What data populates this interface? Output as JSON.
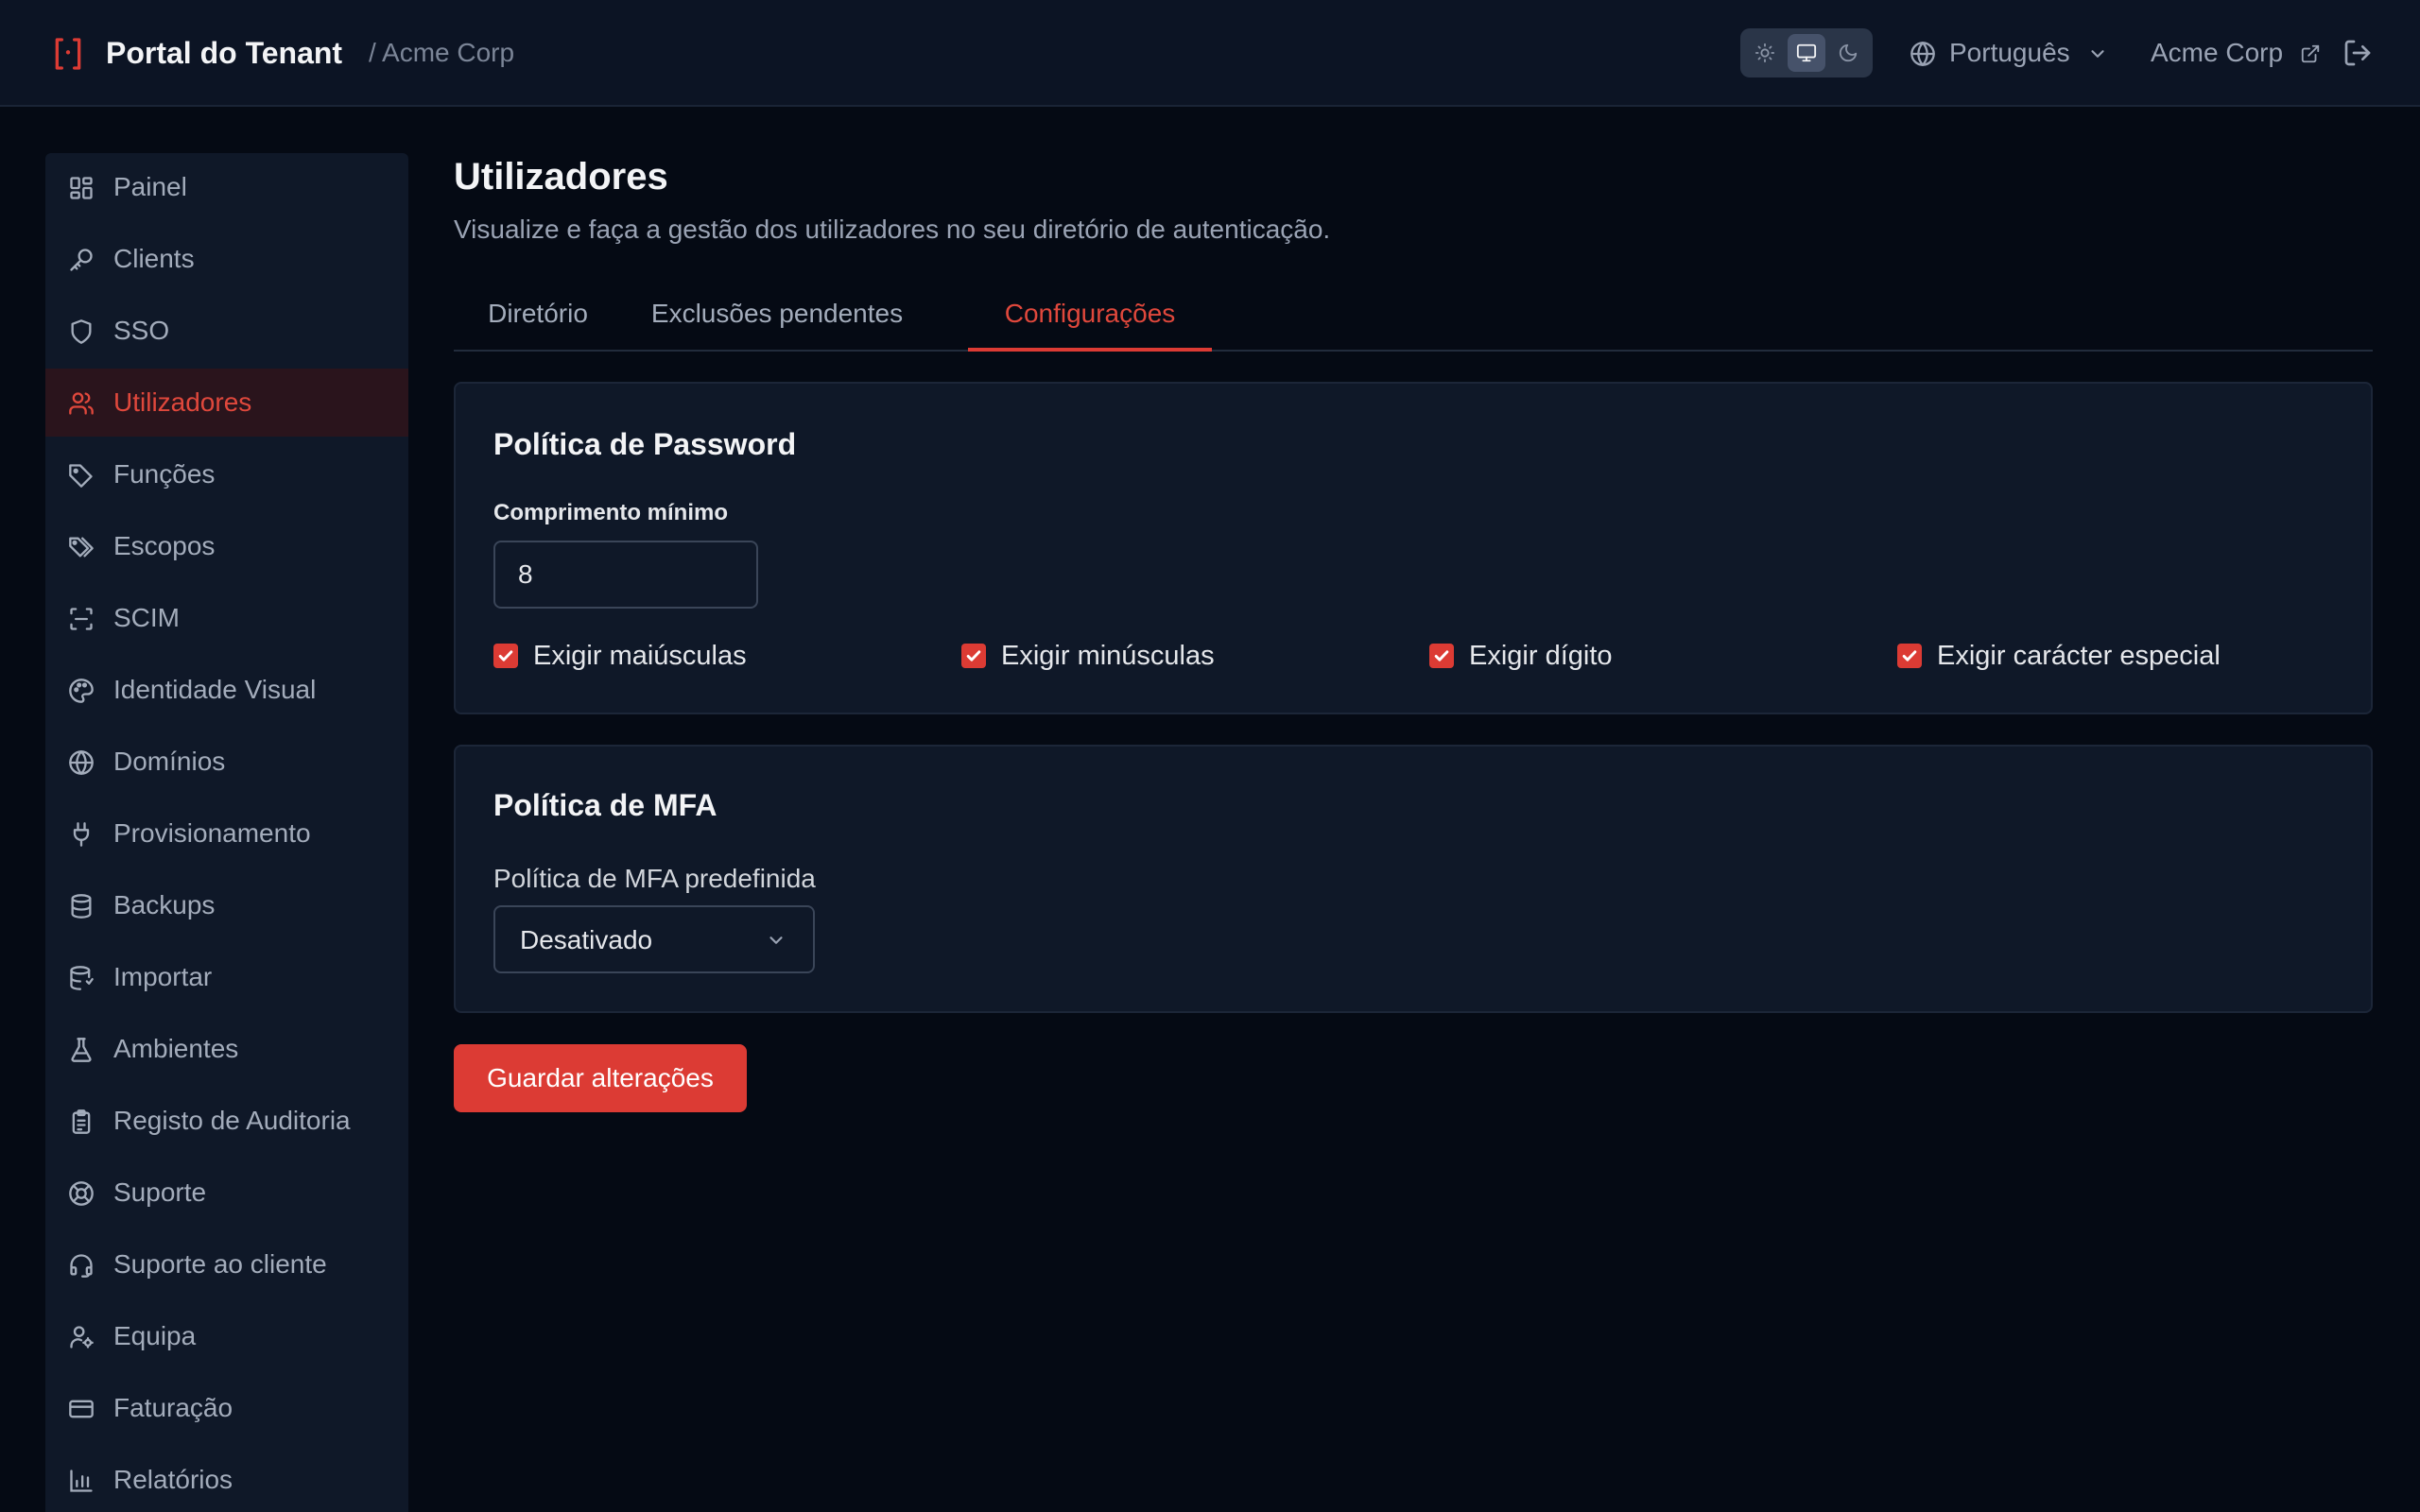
{
  "header": {
    "app_title": "Portal do Tenant",
    "tenant_crumb": "/ Acme Corp",
    "theme_options": [
      {
        "name": "light",
        "icon": "sun-icon",
        "active": false
      },
      {
        "name": "system",
        "icon": "monitor-icon",
        "active": true
      },
      {
        "name": "dark",
        "icon": "moon-icon",
        "active": false
      }
    ],
    "language": {
      "label": "Português",
      "icon": "globe-icon"
    },
    "account": {
      "label": "Acme Corp",
      "icon": "external-link-icon"
    },
    "logout_icon": "logout-icon"
  },
  "sidebar": {
    "items": [
      {
        "label": "Painel",
        "icon": "dashboard-icon",
        "active": false
      },
      {
        "label": "Clients",
        "icon": "key-icon",
        "active": false
      },
      {
        "label": "SSO",
        "icon": "shield-icon",
        "active": false
      },
      {
        "label": "Utilizadores",
        "icon": "users-icon",
        "active": true
      },
      {
        "label": "Funções",
        "icon": "tag-icon",
        "active": false
      },
      {
        "label": "Escopos",
        "icon": "tags-icon",
        "active": false
      },
      {
        "label": "SCIM",
        "icon": "scan-icon",
        "active": false
      },
      {
        "label": "Identidade Visual",
        "icon": "palette-icon",
        "active": false
      },
      {
        "label": "Domínios",
        "icon": "globe-icon",
        "active": false
      },
      {
        "label": "Provisionamento",
        "icon": "plug-icon",
        "active": false
      },
      {
        "label": "Backups",
        "icon": "database-icon",
        "active": false
      },
      {
        "label": "Importar",
        "icon": "database-import-icon",
        "active": false
      },
      {
        "label": "Ambientes",
        "icon": "flask-icon",
        "active": false
      },
      {
        "label": "Registo de Auditoria",
        "icon": "clipboard-list-icon",
        "active": false
      },
      {
        "label": "Suporte",
        "icon": "lifebuoy-icon",
        "active": false
      },
      {
        "label": "Suporte ao cliente",
        "icon": "headset-icon",
        "active": false
      },
      {
        "label": "Equipa",
        "icon": "user-cog-icon",
        "active": false
      },
      {
        "label": "Faturação",
        "icon": "credit-card-icon",
        "active": false
      },
      {
        "label": "Relatórios",
        "icon": "bar-chart-icon",
        "active": false
      }
    ]
  },
  "main": {
    "title": "Utilizadores",
    "subtitle": "Visualize e faça a gestão dos utilizadores no seu diretório de autenticação.",
    "tabs": [
      {
        "label": "Diretório",
        "active": false
      },
      {
        "label": "Exclusões pendentes",
        "active": false
      },
      {
        "label": "Configurações",
        "active": true
      }
    ],
    "password_policy": {
      "title": "Política de Password",
      "min_length_label": "Comprimento mínimo",
      "min_length_value": "8",
      "checkboxes": [
        {
          "label": "Exigir maiúsculas",
          "checked": true
        },
        {
          "label": "Exigir minúsculas",
          "checked": true
        },
        {
          "label": "Exigir dígito",
          "checked": true
        },
        {
          "label": "Exigir carácter especial",
          "checked": true
        }
      ]
    },
    "mfa_policy": {
      "title": "Política de MFA",
      "default_label": "Política de MFA predefinida",
      "selected_value": "Desativado"
    },
    "save_button": "Guardar alterações"
  },
  "colors": {
    "accent": "#dc3b34",
    "background": "#050a14",
    "panel": "#0f1828",
    "header": "#0c1424"
  }
}
